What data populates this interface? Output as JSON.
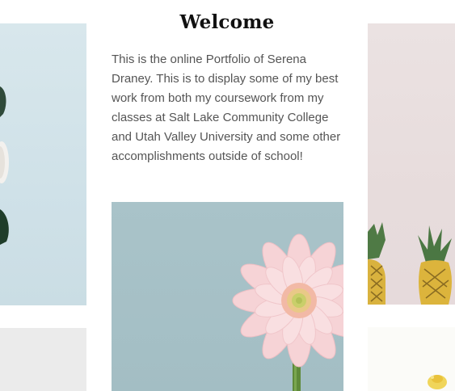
{
  "welcome": {
    "title": "Welcome",
    "intro": "This is the online Portfolio of Serena Draney. This is to display some of my best work from both my coursework from my classes at Salt Lake Community College and Utah Valley University and some other accomplishments outside of school!"
  },
  "images": {
    "left_top": "white-rose-photo",
    "left_bottom": "grey-photo",
    "center": "pink-gerbera-daisy-photo",
    "right_top": "pineapples-photo",
    "right_bottom": "yellow-flower-photo"
  },
  "colors": {
    "photo_blue": "#a9c3c9",
    "left_blue": "#cfe1e8",
    "right_pink": "#e7dcdc",
    "text_grey": "#555555",
    "title_black": "#111111"
  }
}
